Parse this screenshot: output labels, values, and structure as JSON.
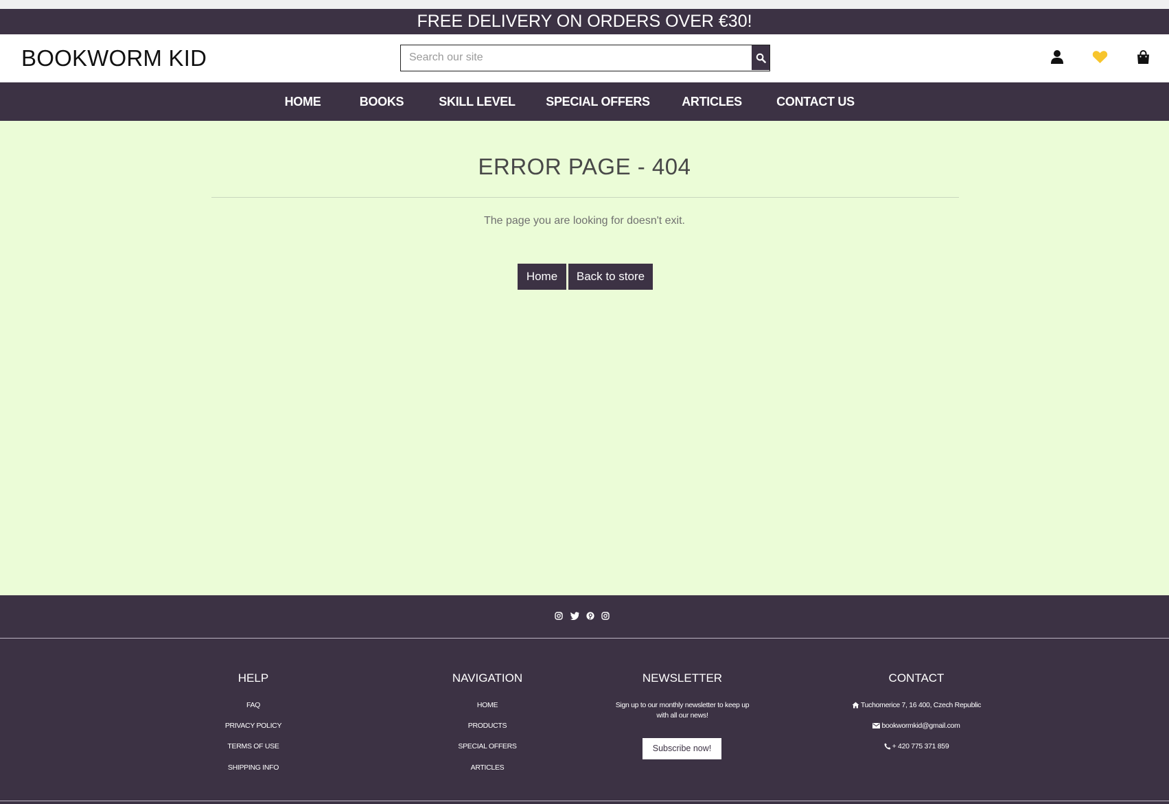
{
  "banner": {
    "text": "FREE DELIVERY ON ORDERS OVER €30!"
  },
  "header": {
    "logo_bold": "BOOKWORM",
    "logo_thin": "KID",
    "search_placeholder": "Search our site",
    "icons": [
      "user-icon",
      "heart-icon",
      "shopping-bag-icon"
    ],
    "heart_color": "#f7c52d"
  },
  "nav": {
    "items": [
      {
        "label": "HOME"
      },
      {
        "label": "BOOKS"
      },
      {
        "label": "SKILL LEVEL"
      },
      {
        "label": "SPECIAL OFFERS"
      },
      {
        "label": "ARTICLES"
      },
      {
        "label": "CONTACT US"
      }
    ]
  },
  "main": {
    "title": "ERROR PAGE - 404",
    "message": "The page you are looking for doesn't exit.",
    "home_button": "Home",
    "store_button": "Back to store"
  },
  "social": {
    "icons": [
      "instagram-icon",
      "twitter-icon",
      "pinterest-icon",
      "instagram-icon"
    ]
  },
  "footer": {
    "help": {
      "heading": "HELP",
      "links": [
        "FAQ",
        "PRIVACY POLICY",
        "TERMS OF USE",
        "SHIPPING INFO"
      ]
    },
    "navigation": {
      "heading": "NAVIGATION",
      "links": [
        "HOME",
        "PRODUCTS",
        "SPECIAL OFFERS",
        "ARTICLES"
      ]
    },
    "newsletter": {
      "heading": "NEWSLETTER",
      "text": "Sign up to our monthly newsletter to keep up with all our news!",
      "button": "Subscribe now!"
    },
    "contact": {
      "heading": "CONTACT",
      "address": "Tuchomerice 7, 16 400, Czech Republic",
      "email": "bookwormkid@gmail.com",
      "phone": "+ 420 775 371 859"
    }
  },
  "colors": {
    "brand": "#3c3244",
    "background": "#ebfcd7",
    "accent": "#f7c52d"
  }
}
